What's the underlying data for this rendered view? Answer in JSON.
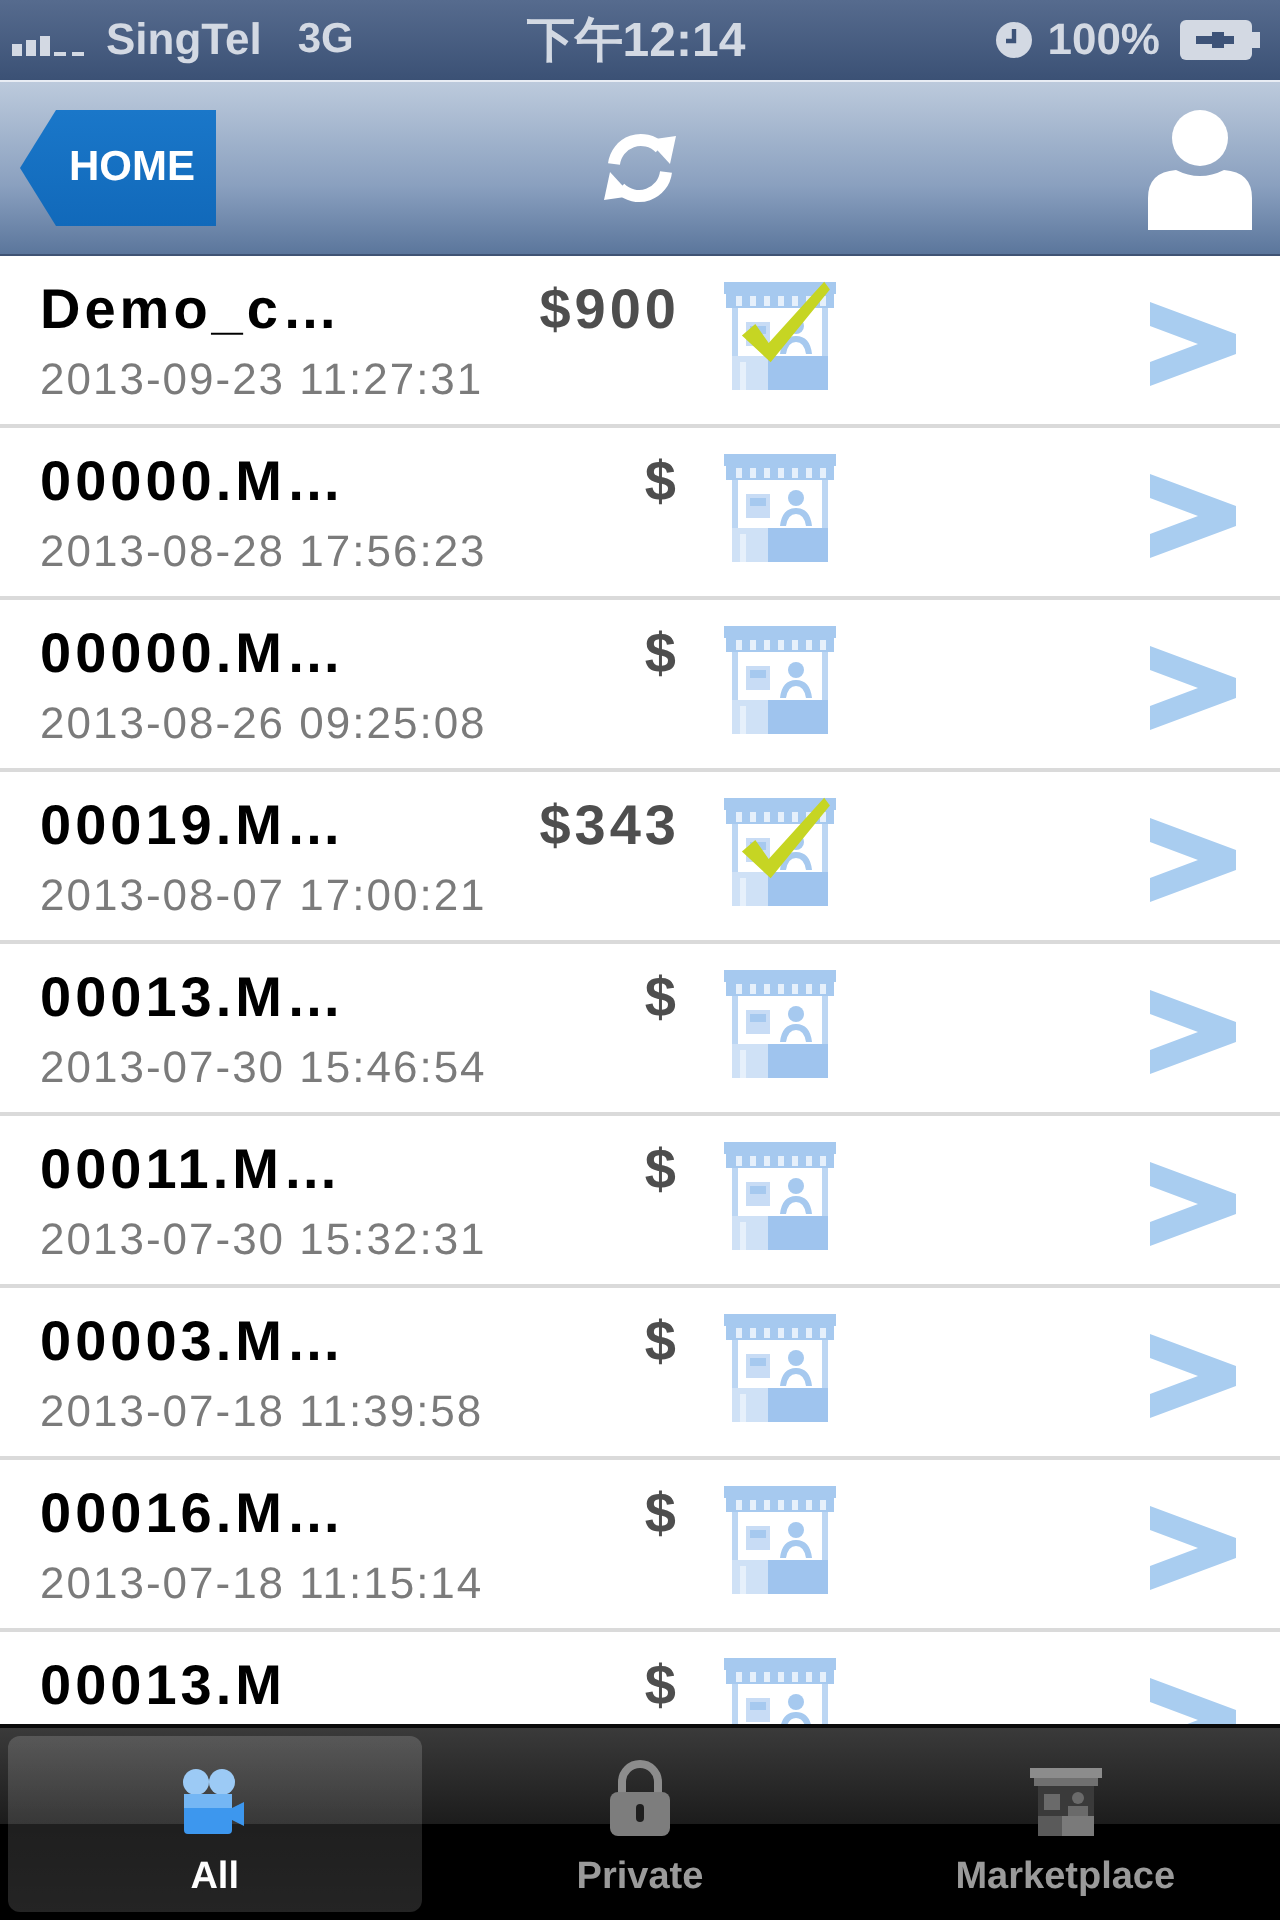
{
  "status_bar": {
    "carrier": "SingTel",
    "network": "3G",
    "time": "下午12:14",
    "battery": "100%"
  },
  "nav_bar": {
    "back_button": "HOME"
  },
  "rows": [
    {
      "title": "Demo_c…",
      "price": "$900",
      "date": "2013-09-23 11:27:31",
      "checked": true
    },
    {
      "title": "00000.M…",
      "price": "$",
      "date": "2013-08-28 17:56:23",
      "checked": false
    },
    {
      "title": "00000.M…",
      "price": "$",
      "date": "2013-08-26 09:25:08",
      "checked": false
    },
    {
      "title": "00019.M…",
      "price": "$343",
      "date": "2013-08-07 17:00:21",
      "checked": true
    },
    {
      "title": "00013.M…",
      "price": "$",
      "date": "2013-07-30 15:46:54",
      "checked": false
    },
    {
      "title": "00011.M…",
      "price": "$",
      "date": "2013-07-30 15:32:31",
      "checked": false
    },
    {
      "title": "00003.M…",
      "price": "$",
      "date": "2013-07-18 11:39:58",
      "checked": false
    },
    {
      "title": "00016.M…",
      "price": "$",
      "date": "2013-07-18 11:15:14",
      "checked": false
    },
    {
      "title": "00013.M",
      "price": "$",
      "checked": false
    }
  ],
  "tab_bar": [
    {
      "label": "All",
      "selected": true
    },
    {
      "label": "Private",
      "selected": false
    },
    {
      "label": "Marketplace",
      "selected": false
    }
  ]
}
